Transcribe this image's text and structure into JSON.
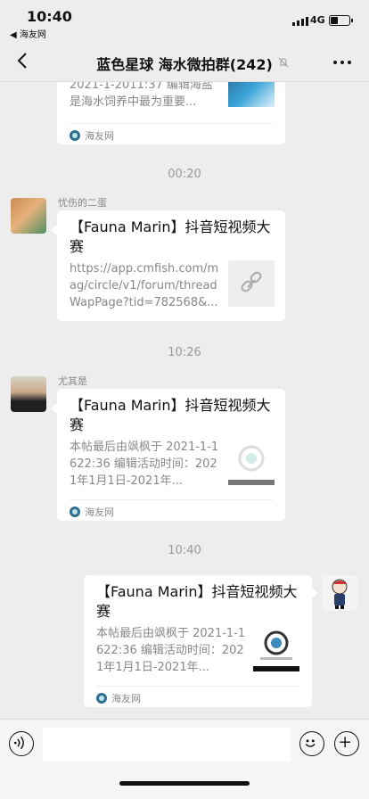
{
  "status_bar": {
    "time": "10:40",
    "back_app": "◀ 海友网",
    "network": "4G",
    "battery_level": 0.4
  },
  "header": {
    "title": "蓝色星球 海水微拍群(242)"
  },
  "messages": [
    {
      "type": "link_card",
      "description": "2021-1-2011:37 编辑海盐是海水饲养中最为重要...",
      "source": "海友网"
    },
    {
      "type": "timestamp",
      "text": "00:20"
    },
    {
      "type": "link_card",
      "sender": "忧伤的二蛋",
      "title": "【Fauna Marin】抖音短视频大赛",
      "description": "https://app.cmfish.com/mag/circle/v1/forum/threadWapPage?tid=782568&..."
    },
    {
      "type": "timestamp",
      "text": "10:26"
    },
    {
      "type": "link_card",
      "sender": "尤其是",
      "title": "【Fauna Marin】抖音短视频大赛",
      "description": "本帖最后由飒枫于 2021-1-1622:36 编辑活动时间：2021年1月1日-2021年...",
      "source": "海友网"
    },
    {
      "type": "timestamp",
      "text": "10:40"
    },
    {
      "type": "link_card",
      "title": "【Fauna Marin】抖音短视频大赛",
      "description": "本帖最后由飒枫于 2021-1-1622:36 编辑活动时间：2021年1月1日-2021年...",
      "source": "海友网"
    }
  ],
  "icons": {
    "back": "chevron-left-icon",
    "mute": "bell-off-icon",
    "more": "more-icon",
    "voice": "voice-icon",
    "emoji": "emoji-icon",
    "plus": "plus-icon",
    "link": "link-icon"
  }
}
